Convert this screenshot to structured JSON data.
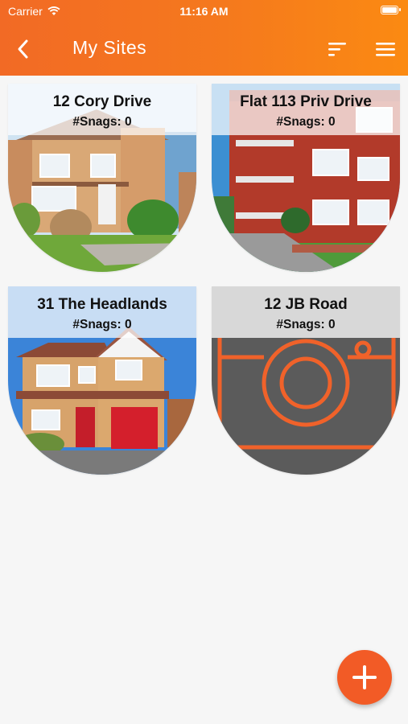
{
  "status_bar": {
    "carrier": "Carrier",
    "time": "11:16 AM"
  },
  "header": {
    "title": "My Sites"
  },
  "sites": [
    {
      "name": "12 Cory Drive",
      "snags": "#Snags: 0"
    },
    {
      "name": "Flat 113 Priv Drive",
      "snags": "#Snags: 0"
    },
    {
      "name": "31 The Headlands",
      "snags": "#Snags: 0"
    },
    {
      "name": "12 JB Road",
      "snags": "#Snags: 0"
    }
  ],
  "colors": {
    "accent": "#f26a25",
    "fab": "#f25b26",
    "placeholder_bg": "#5b5b5b"
  },
  "icons": [
    "back-icon",
    "sort-icon",
    "menu-icon",
    "camera-icon",
    "plus-icon",
    "wifi-icon",
    "battery-icon"
  ]
}
